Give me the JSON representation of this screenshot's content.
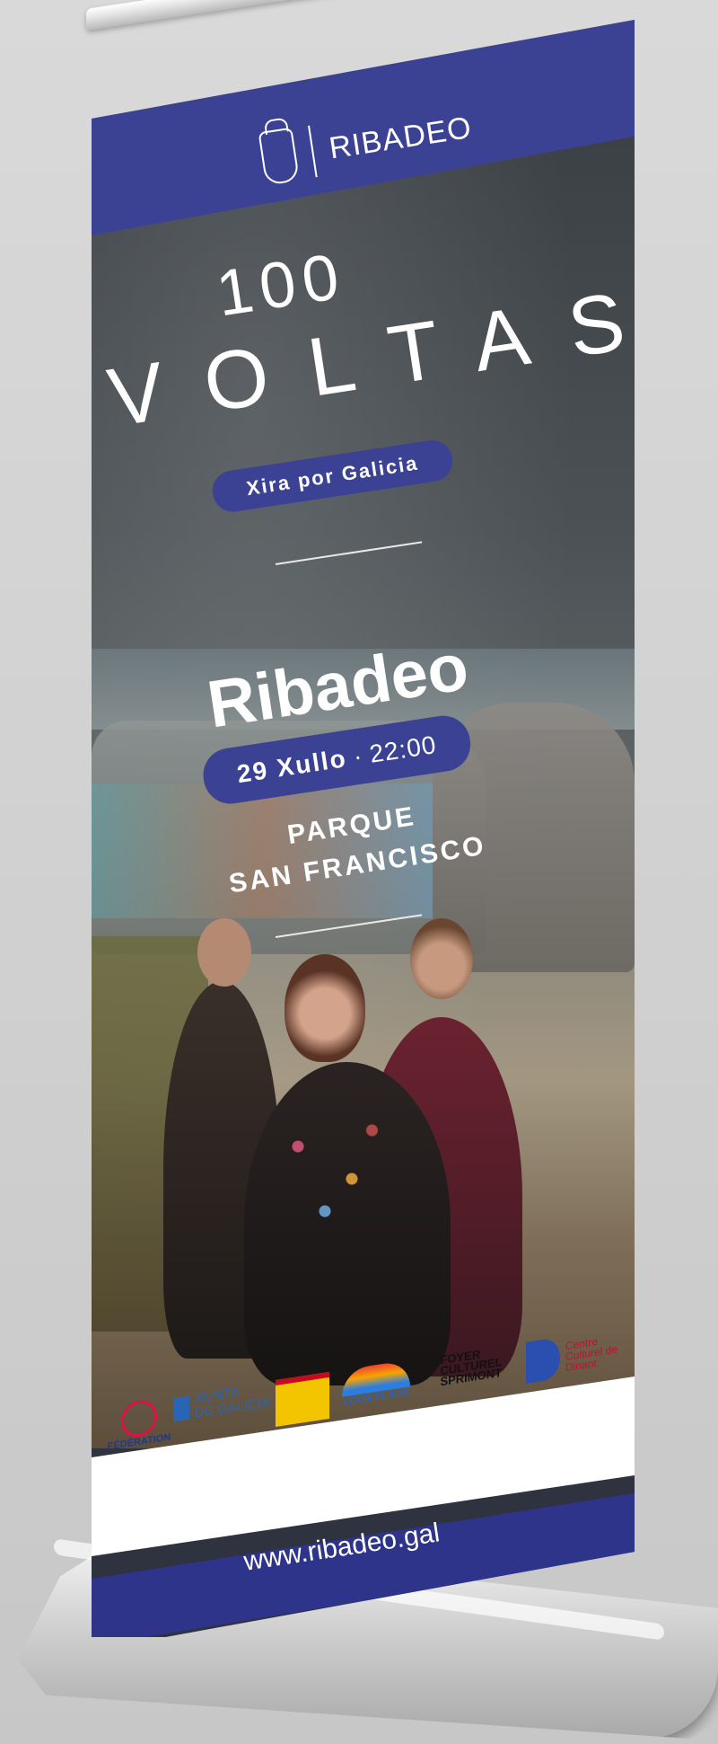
{
  "brand": {
    "name": "RIBADEO",
    "crest_icon": "coat-of-arms-icon"
  },
  "title": {
    "number": "100",
    "word": "VOLTAS",
    "tour": "Xira por Galicia"
  },
  "event": {
    "place": "Ribadeo",
    "date": "29 Xullo",
    "separator": "·",
    "time": "22:00",
    "venue_line1": "PARQUE",
    "venue_line2": "SAN FRANCISCO"
  },
  "sponsors": [
    {
      "name": "FÉDÉRATION",
      "icon": "federation-logo-icon"
    },
    {
      "name": "XUNTA\nDE GALICIA",
      "icon": "xunta-logo-icon"
    },
    {
      "name": "",
      "icon": "spain-ministry-logo-icon"
    },
    {
      "name": "LOON-PLAGE",
      "icon": "loon-plage-logo-icon"
    },
    {
      "name": "FOYER\nCULTUREL\nSPRIMONT",
      "icon": "foyer-culturel-logo-icon"
    },
    {
      "name": "Centre\nCulturel de\nDinant",
      "icon": "centre-culturel-logo-icon"
    }
  ],
  "footer": {
    "url": "www.ribadeo.gal"
  },
  "colors": {
    "accent": "#3b4294",
    "footer": "#2d348a",
    "text": "#ffffff"
  }
}
